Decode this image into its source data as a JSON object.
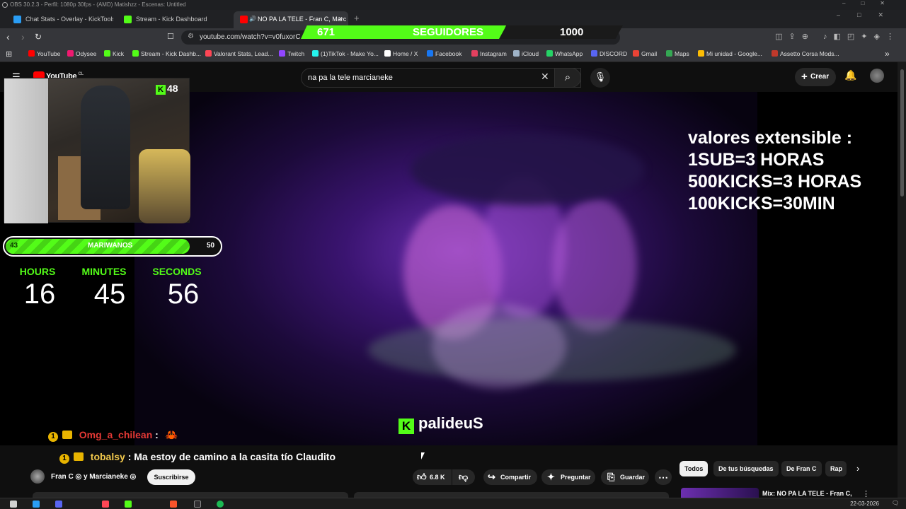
{
  "obs_bar": {
    "title": "OBS 30.2.3 - Perfil: 1080p 30fps - (AMD) Matishzz - Escenas: Untitled"
  },
  "browser": {
    "tabs": [
      {
        "label": "Chat Stats - Overlay - KickTools",
        "icon_color": "#2a9df4"
      },
      {
        "label": "Stream - Kick Dashboard",
        "icon_color": "#53fc18"
      },
      {
        "label": "NO PA LA TELE - Fran C, Marc",
        "icon_color": "#ff0000",
        "active": true
      }
    ],
    "url": "youtube.com/watch?v=v0fuxorC",
    "bookmarks": [
      {
        "label": "YouTube",
        "color": "#ff0000"
      },
      {
        "label": "Odysee",
        "color": "#ef1970"
      },
      {
        "label": "Kick",
        "color": "#53fc18"
      },
      {
        "label": "Stream - Kick Dashb...",
        "color": "#53fc18"
      },
      {
        "label": "Valorant Stats, Lead...",
        "color": "#ff4655"
      },
      {
        "label": "Twitch",
        "color": "#9146ff"
      },
      {
        "label": "(1)TikTok - Make Yo...",
        "color": "#25f4ee"
      },
      {
        "label": "Home / X",
        "color": "#ffffff"
      },
      {
        "label": "Facebook",
        "color": "#1877f2"
      },
      {
        "label": "Instagram",
        "color": "#e4405f"
      },
      {
        "label": "iCloud",
        "color": "#9fb3c8"
      },
      {
        "label": "WhatsApp",
        "color": "#25d366"
      },
      {
        "label": "DISCORD",
        "color": "#5865f2"
      },
      {
        "label": "Gmail",
        "color": "#ea4335"
      },
      {
        "label": "Maps",
        "color": "#34a853"
      },
      {
        "label": "Mi unidad - Google...",
        "color": "#fbbc04"
      },
      {
        "label": "Assetto Corsa Mods...",
        "color": "#c0392b"
      }
    ]
  },
  "follower_goal": {
    "current": "671",
    "label": "SEGUIDORES",
    "target": "1000",
    "progress": 0.671
  },
  "youtube": {
    "logo": "YouTube",
    "country": "CL",
    "search_value": "na pa la tele marcianeke",
    "create_label": "Crear"
  },
  "cam_overlay": {
    "kick_count": "48"
  },
  "goal_bar": {
    "current": "43",
    "label": "MARIWANOS",
    "target": "50",
    "progress": 0.86
  },
  "timer": {
    "labels": [
      "HOURS",
      "MINUTES",
      "SECONDS"
    ],
    "values": [
      "16",
      "45",
      "56"
    ]
  },
  "extensible": {
    "lines": [
      "valores extensible :",
      "1SUB=3 HORAS",
      "500KICKS=3 HORAS",
      "100KICKS=30MIN"
    ]
  },
  "watermark": "palideuS",
  "chat": [
    {
      "badge": "1",
      "user": "Omg_a_chilean",
      "sep": ":",
      "message": ""
    },
    {
      "badge": "1",
      "user": "tobalsy",
      "sep": ":",
      "message": "Ma estoy de camino a la casita tío Claudito"
    }
  ],
  "video_info": {
    "channel": "Fran C ◎ y Marcianeke ◎",
    "subscribe": "Suscribirse",
    "likes": "6.8 K",
    "share": "Compartir",
    "ask": "Preguntar",
    "save": "Guardar",
    "more": "⋯"
  },
  "chips": [
    "Todos",
    "De tus búsquedas",
    "De Fran C",
    "Rap"
  ],
  "up_next": {
    "title": "Mix: NO PA LA TELE - Fran C,"
  },
  "taskbar": {
    "date": "22-03-2026"
  },
  "colors": {
    "kick_green": "#53fc18",
    "yt_red": "#ff0000",
    "chat_user_red": "#e53935"
  }
}
